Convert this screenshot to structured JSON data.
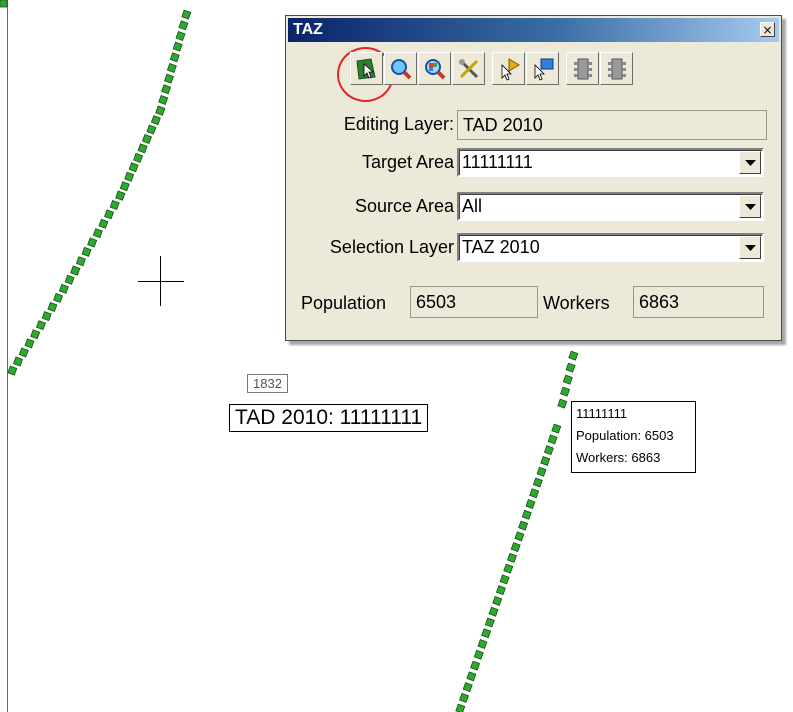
{
  "dialog": {
    "title": "TAZ",
    "close_glyph": "×",
    "toolbar": [
      {
        "icon": "select-area-icon",
        "highlighted": true
      },
      {
        "icon": "zoom-icon"
      },
      {
        "icon": "zoom-color-icon"
      },
      {
        "icon": "settings-tools-icon"
      },
      {
        "icon": "pointer-arrow-icon"
      },
      {
        "icon": "pointer-box-icon"
      },
      {
        "icon": "traffic-light-icon"
      },
      {
        "icon": "traffic-light-icon"
      }
    ],
    "editing_layer": {
      "label": "Editing Layer:",
      "value": "TAD 2010"
    },
    "target_area": {
      "label": "Target Area",
      "value": "11111111"
    },
    "source_area": {
      "label": "Source Area",
      "value": "All"
    },
    "selection_layer": {
      "label": "Selection Layer",
      "value": "TAZ 2010"
    },
    "population": {
      "label": "Population",
      "value": "6503"
    },
    "workers": {
      "label": "Workers",
      "value": "6863"
    },
    "highlight_color": "#e32525"
  },
  "map": {
    "id_label": "1832",
    "tad_label": "TAD 2010: 11111111",
    "info_box": {
      "id": "11111111",
      "population": "Population: 6503",
      "workers": "Workers: 6863"
    },
    "boundary_color": "#2ea82e",
    "frame_color": "#3b6fb6"
  }
}
